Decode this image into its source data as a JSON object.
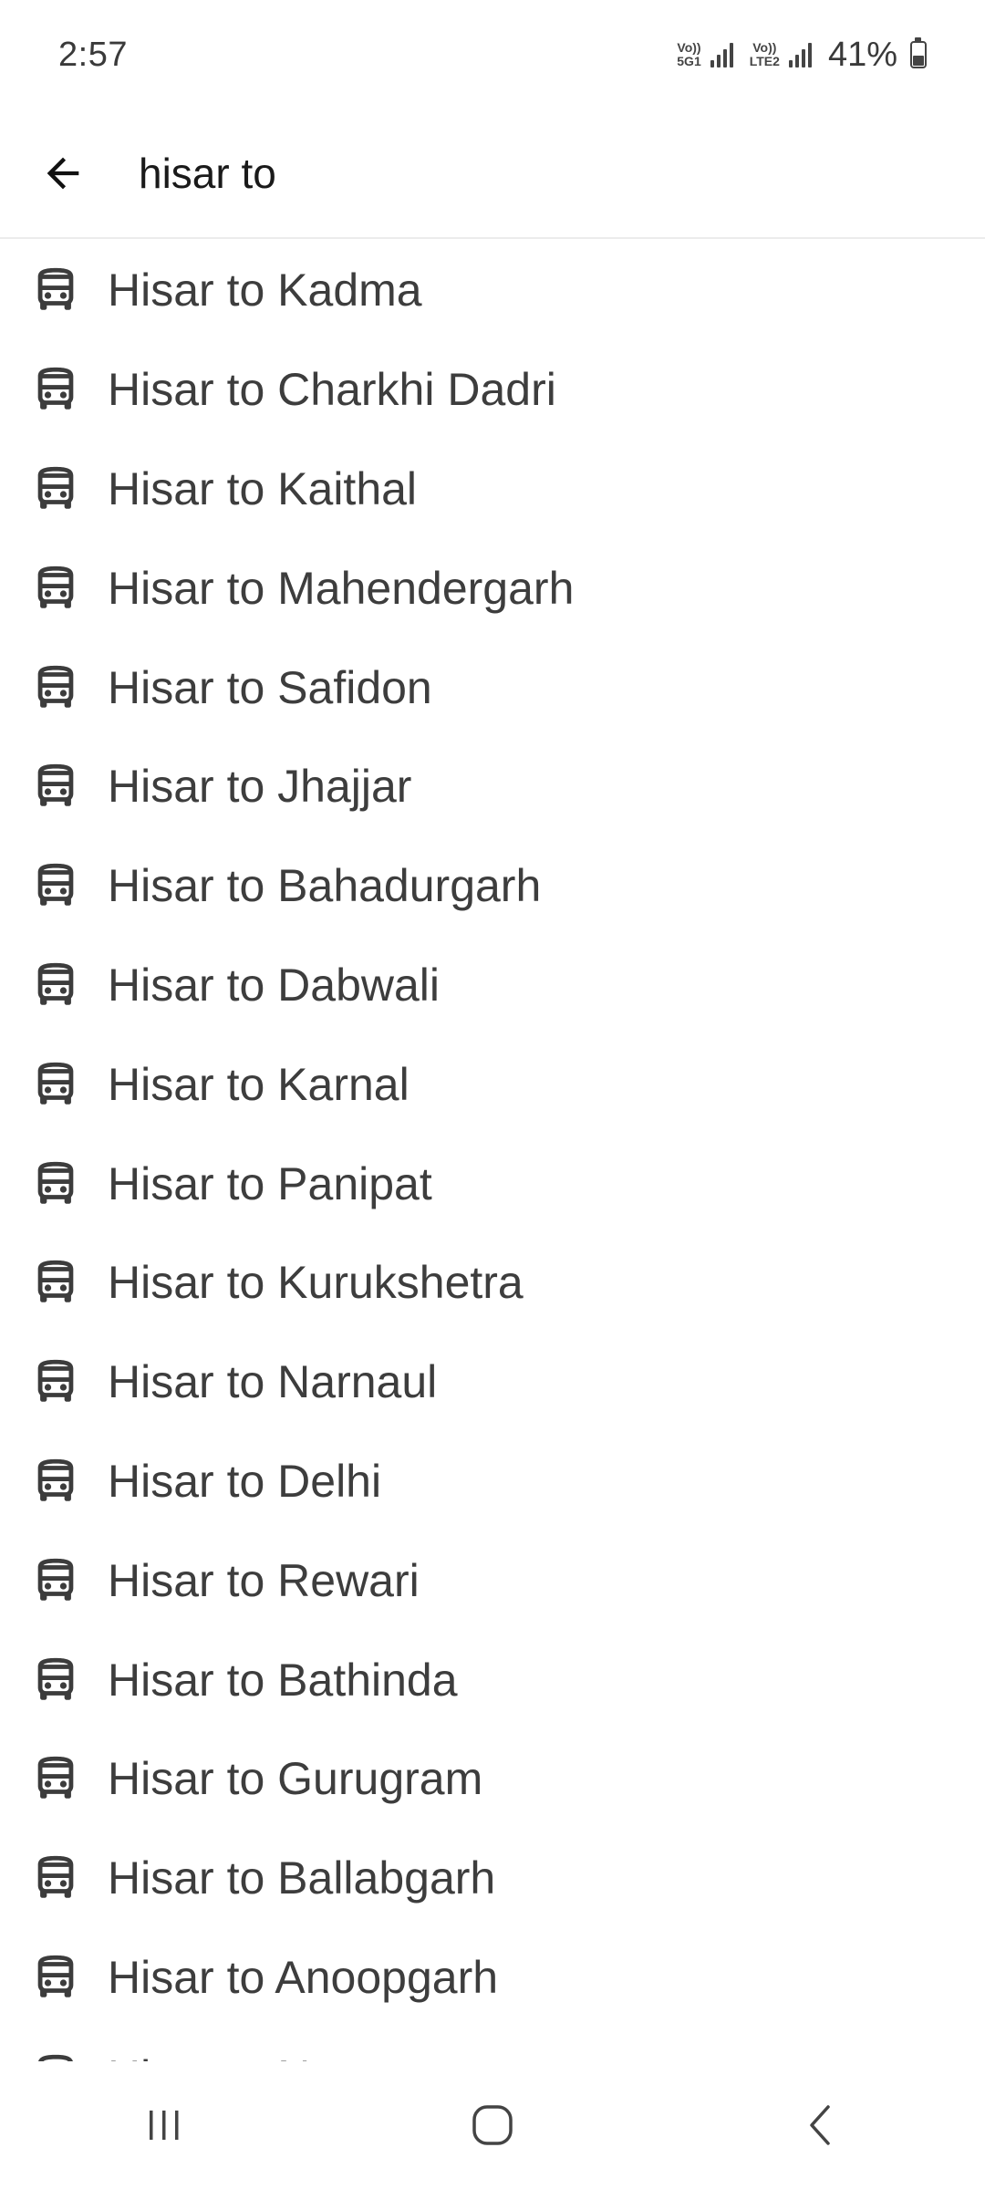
{
  "status_bar": {
    "time": "2:57",
    "sim1_label_top": "Vo))",
    "sim1_label_bottom": "5G1",
    "sim2_label_top": "Vo))",
    "sim2_label_bottom": "LTE2",
    "battery": "41%",
    "battery_level_fraction": 0.41
  },
  "search": {
    "query": "hisar to",
    "back_icon": "arrow-left-icon"
  },
  "suggestions": {
    "icon": "bus-icon",
    "items": [
      {
        "label": "Hisar to Kadma"
      },
      {
        "label": "Hisar to Charkhi Dadri"
      },
      {
        "label": "Hisar to Kaithal"
      },
      {
        "label": "Hisar to Mahendergarh"
      },
      {
        "label": "Hisar to Safidon"
      },
      {
        "label": "Hisar to Jhajjar"
      },
      {
        "label": "Hisar to Bahadurgarh"
      },
      {
        "label": "Hisar to Dabwali"
      },
      {
        "label": "Hisar to Karnal"
      },
      {
        "label": "Hisar to Panipat"
      },
      {
        "label": "Hisar to Kurukshetra"
      },
      {
        "label": "Hisar to Narnaul"
      },
      {
        "label": "Hisar to Delhi"
      },
      {
        "label": "Hisar to Rewari"
      },
      {
        "label": "Hisar to Bathinda"
      },
      {
        "label": "Hisar to Gurugram"
      },
      {
        "label": "Hisar to Ballabgarh"
      },
      {
        "label": "Hisar to Anoopgarh"
      },
      {
        "label": "Hisar to Na"
      }
    ]
  },
  "nav_bar": {
    "recents_icon": "recents-icon",
    "home_icon": "home-icon",
    "back_icon": "back-chevron-icon"
  },
  "colors": {
    "text": "#3d3d3d",
    "icon": "#3c3c3c",
    "divider": "#ececec",
    "background": "#ffffff"
  }
}
